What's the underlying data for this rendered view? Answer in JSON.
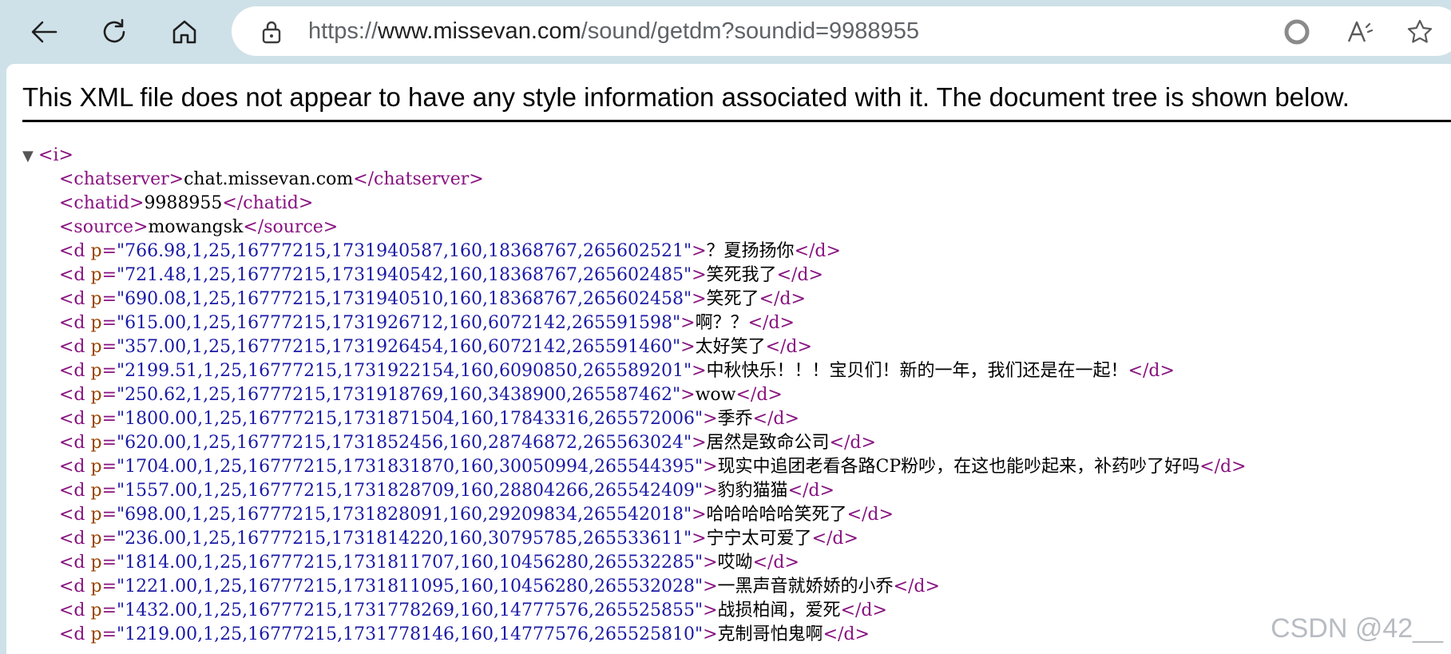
{
  "browser": {
    "url_scheme": "https://",
    "url_host": "www.missevan.com",
    "url_path": "/sound/getdm?soundid=9988955",
    "icons": [
      "back-arrow-icon",
      "refresh-icon",
      "home-icon",
      "lock-icon",
      "edge-refresh-icon",
      "read-aloud-icon",
      "favorite-star-icon"
    ]
  },
  "xml_viewer": {
    "notice": "This XML file does not appear to have any style information associated with it. The document tree is shown below.",
    "root_tag": "i",
    "triangle": "▼",
    "chatserver": "chat.missevan.com",
    "chatid": "9988955",
    "source": "mowangsk",
    "danmaku": [
      {
        "p": "766.98,1,25,16777215,1731940587,160,18368767,265602521",
        "text": "？夏扬扬你"
      },
      {
        "p": "721.48,1,25,16777215,1731940542,160,18368767,265602485",
        "text": "笑死我了"
      },
      {
        "p": "690.08,1,25,16777215,1731940510,160,18368767,265602458",
        "text": "笑死了"
      },
      {
        "p": "615.00,1,25,16777215,1731926712,160,6072142,265591598",
        "text": "啊？？"
      },
      {
        "p": "357.00,1,25,16777215,1731926454,160,6072142,265591460",
        "text": "太好笑了"
      },
      {
        "p": "2199.51,1,25,16777215,1731922154,160,6090850,265589201",
        "text": "中秋快乐！！！宝贝们！新的一年，我们还是在一起！"
      },
      {
        "p": "250.62,1,25,16777215,1731918769,160,3438900,265587462",
        "text": "wow"
      },
      {
        "p": "1800.00,1,25,16777215,1731871504,160,17843316,265572006",
        "text": "季乔"
      },
      {
        "p": "620.00,1,25,16777215,1731852456,160,28746872,265563024",
        "text": "居然是致命公司"
      },
      {
        "p": "1704.00,1,25,16777215,1731831870,160,30050994,265544395",
        "text": "现实中追团老看各路CP粉吵，在这也能吵起来，补药吵了好吗"
      },
      {
        "p": "1557.00,1,25,16777215,1731828709,160,28804266,265542409",
        "text": "豹豹猫猫"
      },
      {
        "p": "698.00,1,25,16777215,1731828091,160,29209834,265542018",
        "text": "哈哈哈哈哈笑死了"
      },
      {
        "p": "236.00,1,25,16777215,1731814220,160,30795785,265533611",
        "text": "宁宁太可爱了"
      },
      {
        "p": "1814.00,1,25,16777215,1731811707,160,10456280,265532285",
        "text": "哎呦"
      },
      {
        "p": "1221.00,1,25,16777215,1731811095,160,10456280,265532028",
        "text": "一黑声音就娇娇的小乔"
      },
      {
        "p": "1432.00,1,25,16777215,1731778269,160,14777576,265525855",
        "text": "战损柏闻，爱死"
      },
      {
        "p": "1219.00,1,25,16777215,1731778146,160,14777576,265525810",
        "text": "克制哥怕鬼啊"
      }
    ]
  },
  "watermark": "CSDN @42__"
}
